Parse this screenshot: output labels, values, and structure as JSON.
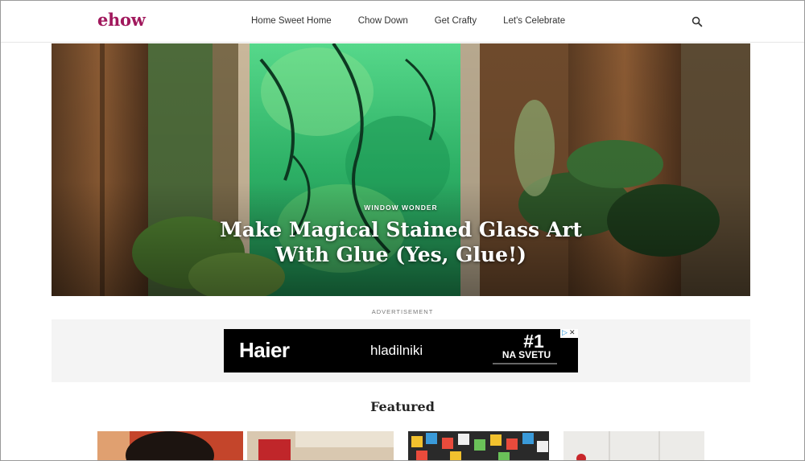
{
  "header": {
    "logo": "ehow",
    "nav": [
      "Home Sweet Home",
      "Chow Down",
      "Get Crafty",
      "Let's Celebrate"
    ],
    "search_icon": "search-icon"
  },
  "hero": {
    "eyebrow": "WINDOW WONDER",
    "title": "Make Magical Stained Glass Art With Glue (Yes, Glue!)"
  },
  "ad": {
    "label": "ADVERTISEMENT",
    "brand": "Haier",
    "product": "hladilniki",
    "rank": "#1",
    "rank_sub": "NA SVETU",
    "choices_icon": "ad-choices-icon"
  },
  "featured": {
    "title": "Featured"
  },
  "colors": {
    "brand": "#a1195d",
    "ad_bg": "#000000",
    "band_bg": "#f4f4f4"
  }
}
